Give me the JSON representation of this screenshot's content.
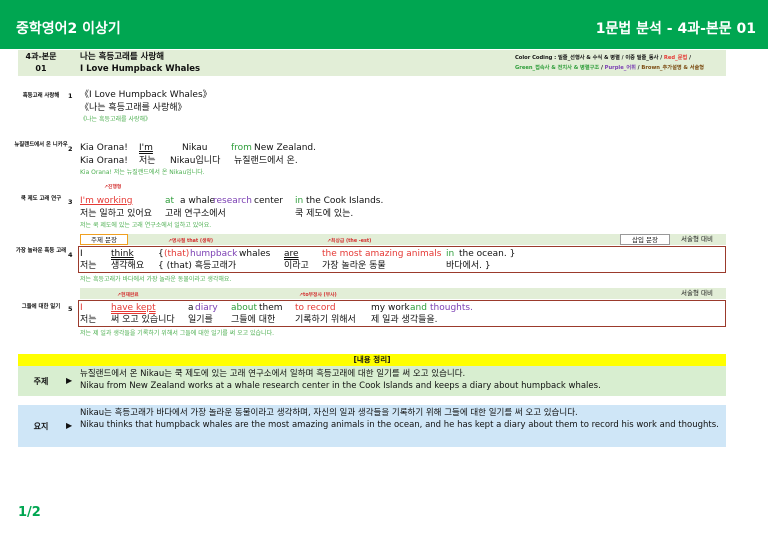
{
  "header": {
    "left": "중학영어2 이상기",
    "right": "1문법 분석 - 4과-본문 01"
  },
  "lesson": {
    "num": "4과-본문\n01",
    "title_ko": "나는 흑등고래를 사랑해",
    "title_en": "I Love Humpback Whales",
    "code_prefix": "Color Coding : 밑줄_선행사 & 수식 & 병렬 / 이중 밑줄_동사 / ",
    "code_red": "Red_문법",
    "code_slash1": " / ",
    "code_green": "Green_접속사 & 전치사 & 병렬구조",
    "code_slash2": " / ",
    "code_purple": "Purple_어휘",
    "code_slash3": " / ",
    "code_brown": "Brown_추가설명 & 서술형"
  },
  "rows": {
    "r1": {
      "label": "흑등고래 사랑해",
      "num": "1",
      "en": "《I Love Humpback Whales》",
      "ko": "《나는 흑등고래를 사랑해》",
      "note": "《나는 흑등고래를 사랑해》"
    },
    "r2": {
      "label": "뉴질랜드에서 온 니카우",
      "num": "2",
      "en1": "Kia Orana!",
      "en2": "I'm",
      "en3": "Nikau",
      "en4": "from",
      "en5": "New Zealand.",
      "ko1": "Kia Orana!",
      "ko2": "저는",
      "ko3": "Nikau입니다",
      "ko4": "뉴질랜드에서 온.",
      "note": "Kia Orana! 저는 뉴질랜드에서 온 Nikau입니다."
    },
    "r3": {
      "label": "쿡 제도 고래 연구",
      "num": "3",
      "tag": "진행형",
      "en1": "I'm working",
      "en2": "at",
      "en3": "a whale",
      "en4": "research",
      "en5": "center",
      "en6": "in",
      "en7": "the Cook Islands.",
      "ko1": "저는 일하고 있어요",
      "ko2": "고래 연구소에서",
      "ko3": "쿡 제도에 있는.",
      "note": "저는 쿡 제도에 있는 고래 연구소에서 일하고 있어요."
    },
    "r4": {
      "label": "가장 놀라운 흑등 고래",
      "num": "4",
      "main_box": "주제 문장",
      "insert_box": "삽입 문장",
      "essay_box": "서술형 대비",
      "tag1": "명사절 that (생략)",
      "tag2": "최상급 (the -est)",
      "en1": "I",
      "en2": "think",
      "en3": "{",
      "en4": "(that)",
      "en5": "humpback",
      "en6": "whales",
      "en7": "are",
      "en8": "the most amazing animals",
      "en9": "in",
      "en10": "the ocean. }",
      "ko1": "저는",
      "ko2": "생각해요",
      "ko3": "{ (that) 흑등고래가",
      "ko4": "이라고",
      "ko5": "가장 놀라운 동물",
      "ko6": "바다에서. }",
      "note": "저는 흑등고래가 바다에서 가장 놀라운 동물이라고 생각해요."
    },
    "r5": {
      "label": "그들에 대한 일기",
      "num": "5",
      "essay_box": "서술형 대비",
      "tag1": "현재완료",
      "tag2": "to부정사 (부사)",
      "en1": "I",
      "en2": "have kept",
      "en3": "a",
      "en4": "diary",
      "en5": "about",
      "en6": "them",
      "en7": "to record",
      "en8": "my work",
      "en9": "and",
      "en10": "thoughts.",
      "ko1": "저는",
      "ko2": "써 오고 있습니다",
      "ko3": "일기를",
      "ko4": "그들에 대한",
      "ko5": "기록하기 위해서",
      "ko6": "제 일과 생각들을.",
      "note": "저는 제 일과 생각들을 기록하기 위해서 그들에 대한 일기를 써 오고 있습니다."
    }
  },
  "summary": {
    "title": "[내용 정리]",
    "theme_label": "주제",
    "theme_ko": "뉴질랜드에서 온 Nikau는 쿡 제도에 있는 고래 연구소에서 일하며 흑등고래에 대한 일기를 써 오고 있습니다.",
    "theme_en": "Nikau from New Zealand works at a whale research center in the Cook Islands and keeps a diary about humpback whales.",
    "gist_label": "요지",
    "gist_ko": "Nikau는 흑등고래가 바다에서 가장 놀라운 동물이라고 생각하며, 자신의 일과 생각들을 기록하기 위해 그들에 대한 일기를 써 오고 있습니다.",
    "gist_en": "Nikau thinks that humpback whales are the most amazing animals in the ocean, and he has kept a diary about them to record his work and thoughts.",
    "arrow": "▶"
  },
  "page": "1/2",
  "colors": {
    "green": "#00a651",
    "light_green": "#e2eed7",
    "frame": "#9b3a2c",
    "summary_bg": "#d8eed0",
    "gist_bg": "#cfe6f7",
    "highlight": "#ffff00"
  }
}
